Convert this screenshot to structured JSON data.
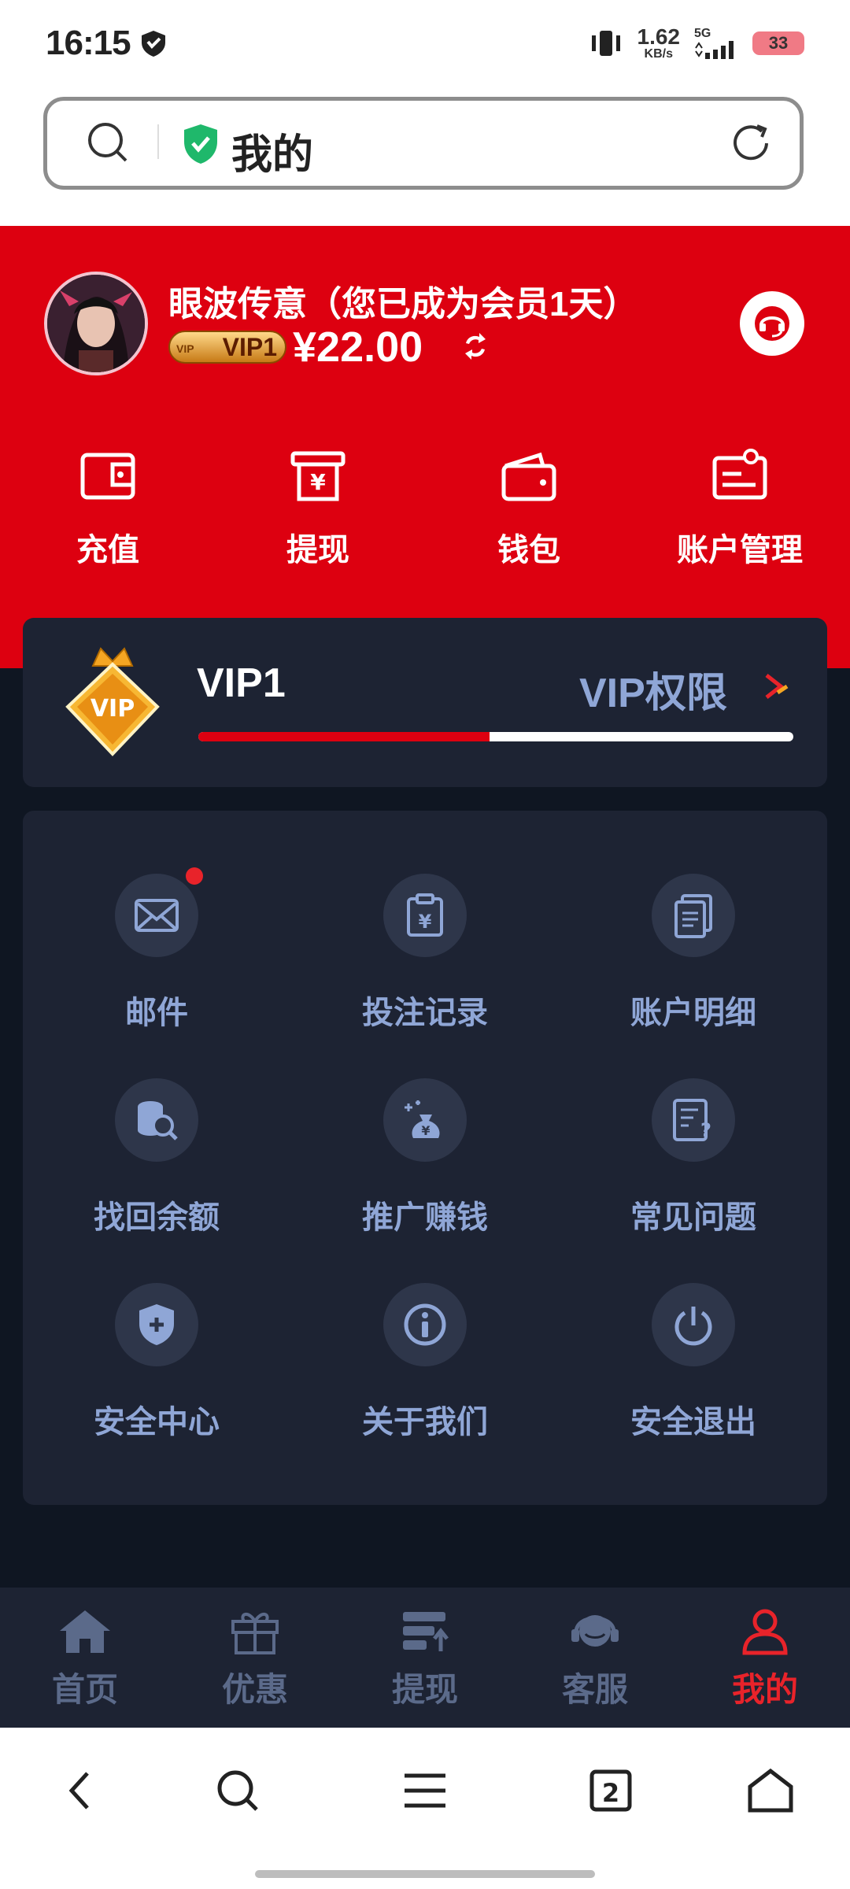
{
  "status_bar": {
    "time": "16:15",
    "network_speed": "1.62",
    "network_unit": "KB/s",
    "network_type": "5G",
    "battery": "33"
  },
  "browser": {
    "url_title": "我的"
  },
  "profile": {
    "username": "眼波传意（您已成为会员1天）",
    "vip_badge": "VIP1",
    "vip_badge_small": "VIP",
    "balance": "¥22.00"
  },
  "quick_actions": [
    {
      "label": "充值",
      "icon": "recharge-icon"
    },
    {
      "label": "提现",
      "icon": "withdraw-icon"
    },
    {
      "label": "钱包",
      "icon": "wallet-icon"
    },
    {
      "label": "账户管理",
      "icon": "account-manage-icon"
    }
  ],
  "vip": {
    "level": "VIP1",
    "perm_link": "VIP权限",
    "progress": 0.49
  },
  "menu": [
    {
      "label": "邮件",
      "icon": "mail-icon",
      "badge": true
    },
    {
      "label": "投注记录",
      "icon": "bet-record-icon"
    },
    {
      "label": "账户明细",
      "icon": "account-detail-icon"
    },
    {
      "label": "找回余额",
      "icon": "recover-balance-icon"
    },
    {
      "label": "推广赚钱",
      "icon": "promote-icon"
    },
    {
      "label": "常见问题",
      "icon": "faq-icon"
    },
    {
      "label": "安全中心",
      "icon": "security-icon"
    },
    {
      "label": "关于我们",
      "icon": "about-icon"
    },
    {
      "label": "安全退出",
      "icon": "logout-icon"
    }
  ],
  "tabs": [
    {
      "label": "首页",
      "icon": "home-icon",
      "active": false
    },
    {
      "label": "优惠",
      "icon": "gift-icon",
      "active": false
    },
    {
      "label": "提现",
      "icon": "withdraw-tab-icon",
      "active": false
    },
    {
      "label": "客服",
      "icon": "support-icon",
      "active": false
    },
    {
      "label": "我的",
      "icon": "user-icon",
      "active": true
    }
  ],
  "colors": {
    "primary_red": "#dd0010",
    "dark_bg": "#0f1622",
    "card_bg": "#1d2333",
    "muted_text": "#8fa6d6",
    "inactive_tab": "#5b6a8a"
  }
}
